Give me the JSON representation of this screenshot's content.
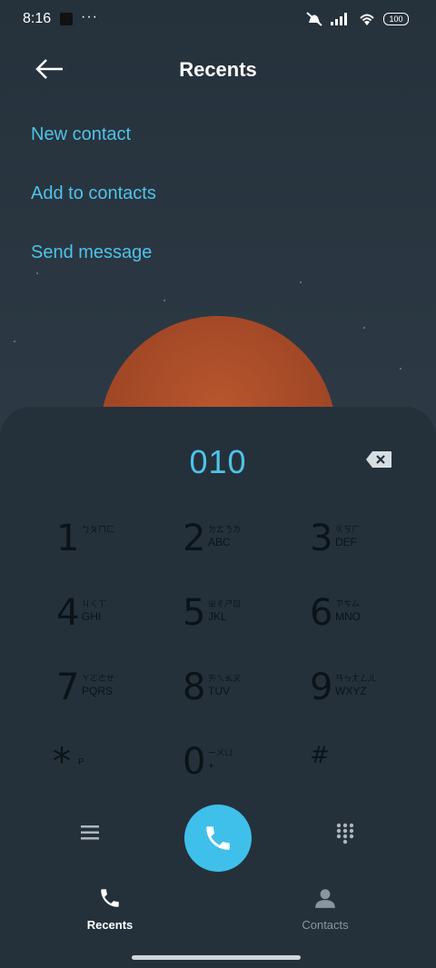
{
  "status_bar": {
    "time": "8:16",
    "dots": "···",
    "battery": "100"
  },
  "header": {
    "title": "Recents",
    "back_icon": "arrow-left-icon"
  },
  "actions": [
    {
      "label": "New contact"
    },
    {
      "label": "Add to contacts"
    },
    {
      "label": "Send message"
    }
  ],
  "dialer": {
    "number": "010",
    "keys": [
      {
        "digit": "1",
        "sub1": "ㄅㄆㄇㄈ",
        "sub2": ""
      },
      {
        "digit": "2",
        "sub1": "ㄉㄊㄋㄌ",
        "sub2": "ABC"
      },
      {
        "digit": "3",
        "sub1": "ㄍㄎㄏ",
        "sub2": "DEF"
      },
      {
        "digit": "4",
        "sub1": "ㄐㄑㄒ",
        "sub2": "GHI"
      },
      {
        "digit": "5",
        "sub1": "ㄓㄔㄕㄖ",
        "sub2": "JKL"
      },
      {
        "digit": "6",
        "sub1": "ㄗㄘㄙ",
        "sub2": "MNO"
      },
      {
        "digit": "7",
        "sub1": "ㄚㄛㄜㄝ",
        "sub2": "PQRS"
      },
      {
        "digit": "8",
        "sub1": "ㄞㄟㄠㄡ",
        "sub2": "TUV"
      },
      {
        "digit": "9",
        "sub1": "ㄢㄣㄤㄥㄦ",
        "sub2": "WXYZ"
      },
      {
        "digit": "*",
        "sub1": "",
        "sub2": "P"
      },
      {
        "digit": "0",
        "sub1": "ㄧㄨㄩ",
        "sub2": "+"
      },
      {
        "digit": "#",
        "sub1": "",
        "sub2": ""
      }
    ]
  },
  "bottom_nav": {
    "recents_label": "Recents",
    "contacts_label": "Contacts"
  },
  "colors": {
    "accent": "#4fc3e8",
    "panel": "#24313b",
    "call_button": "#3fc0ea"
  }
}
